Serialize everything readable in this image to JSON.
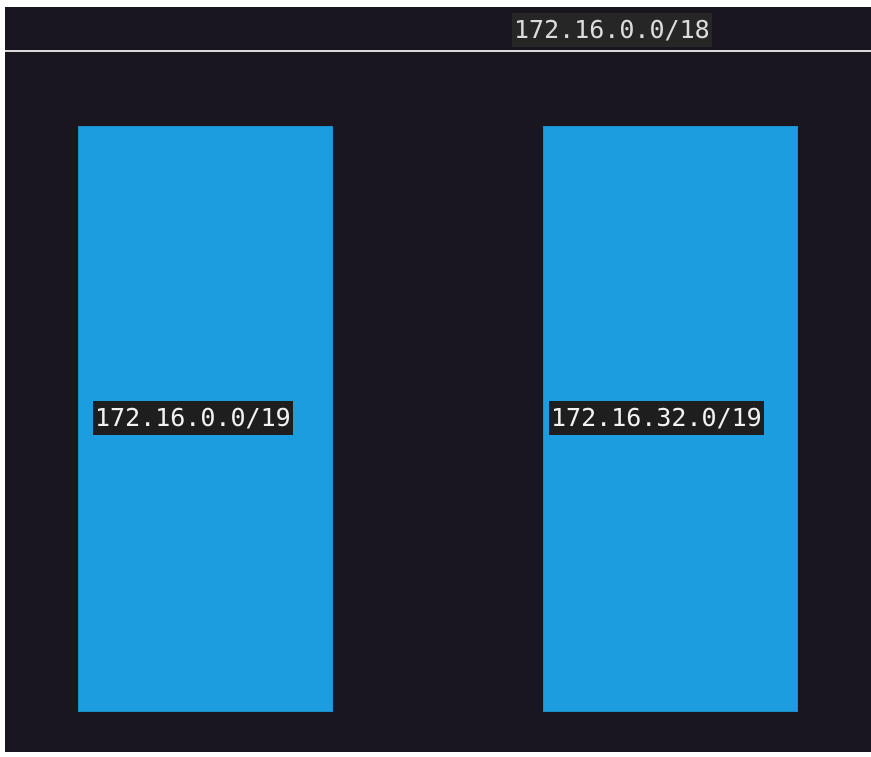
{
  "network": {
    "parent_cidr": "172.16.0.0/18",
    "subnets": [
      {
        "cidr": "172.16.0.0/19"
      },
      {
        "cidr": "172.16.32.0/19"
      }
    ]
  },
  "colors": {
    "background": "#19161f",
    "subnet_fill": "#1c9de0",
    "divider": "#d9d9d9",
    "label_bg": "#1e1e1e",
    "label_text": "#f2f2f2"
  }
}
